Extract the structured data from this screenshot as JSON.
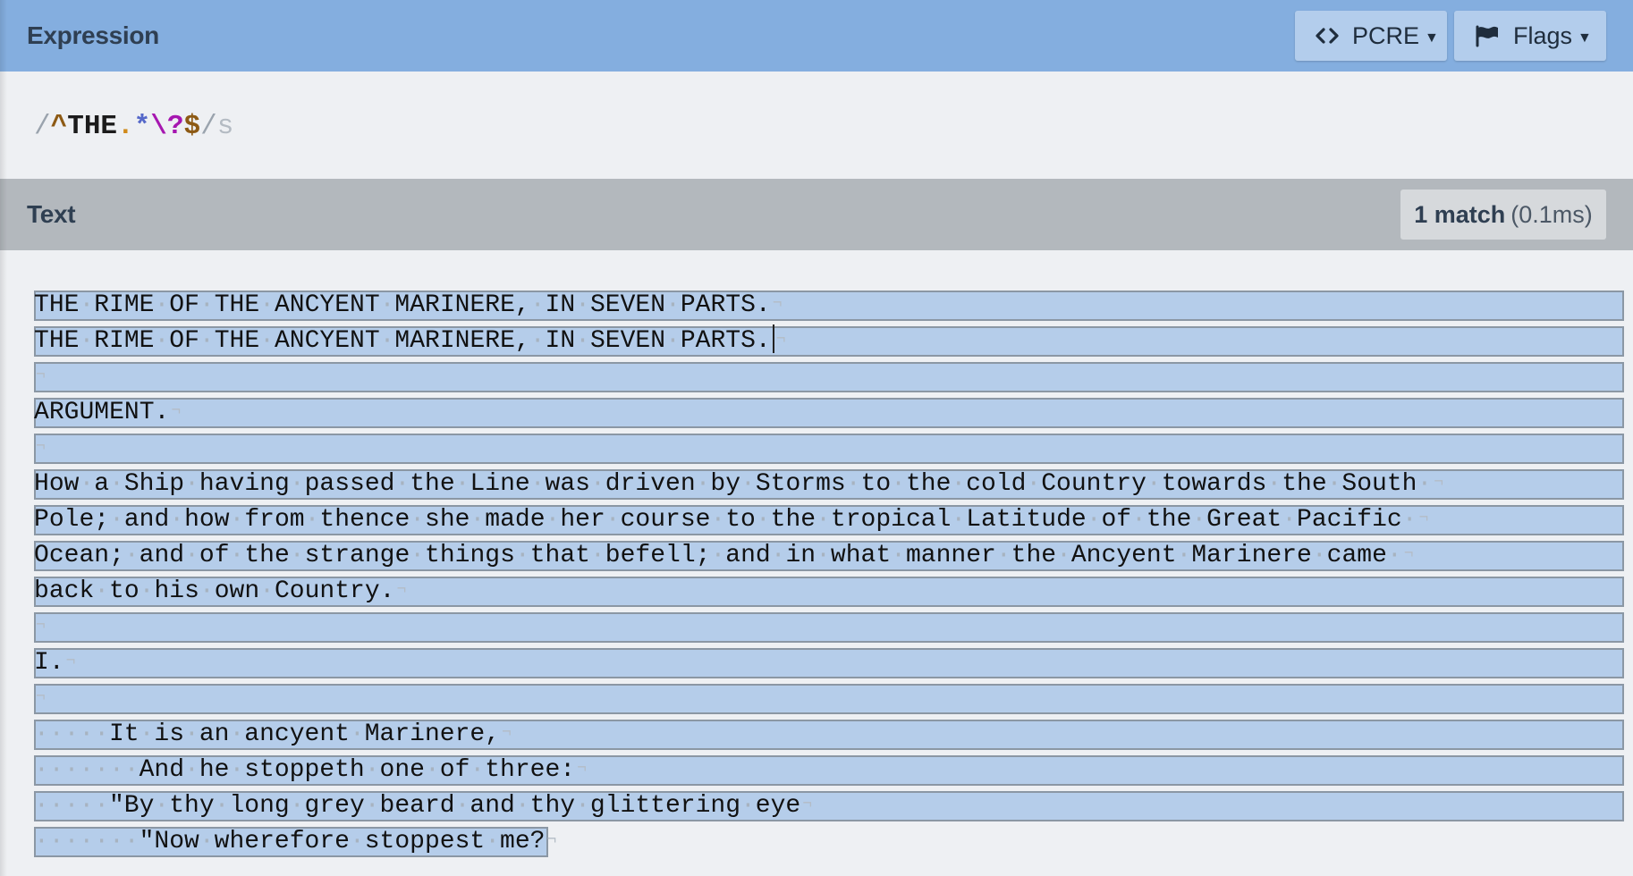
{
  "header": {
    "title": "Expression",
    "pcre_label": "PCRE",
    "flags_label": "Flags"
  },
  "expression": {
    "open_delim": "/",
    "anchor_start": "^",
    "literal": "THE",
    "dot": ".",
    "star": "*",
    "escaped_q": "\\?",
    "anchor_end": "$",
    "close_delim": "/",
    "flags": "s"
  },
  "text_section": {
    "title": "Text",
    "match_count": "1 match",
    "match_time": "(0.1ms)"
  },
  "text_lines": [
    "THE RIME OF THE ANCYENT MARINERE, IN SEVEN PARTS.",
    "THE RIME OF THE ANCYENT MARINERE, IN SEVEN PARTS.",
    "",
    "ARGUMENT.",
    "",
    "How a Ship having passed the Line was driven by Storms to the cold Country towards the South ",
    "Pole; and how from thence she made her course to the tropical Latitude of the Great Pacific ",
    "Ocean; and of the strange things that befell; and in what manner the Ancyent Marinere came ",
    "back to his own Country.",
    "",
    "I.",
    "",
    "     It is an ancyent Marinere,",
    "       And he stoppeth one of three:",
    "     \"By thy long grey beard and thy glittering eye",
    "       \"Now wherefore stoppest me?"
  ],
  "colors": {
    "header_blue": "#84aedf",
    "text_header_gray": "#b3b8bd",
    "match_highlight": "#b5cdea"
  }
}
